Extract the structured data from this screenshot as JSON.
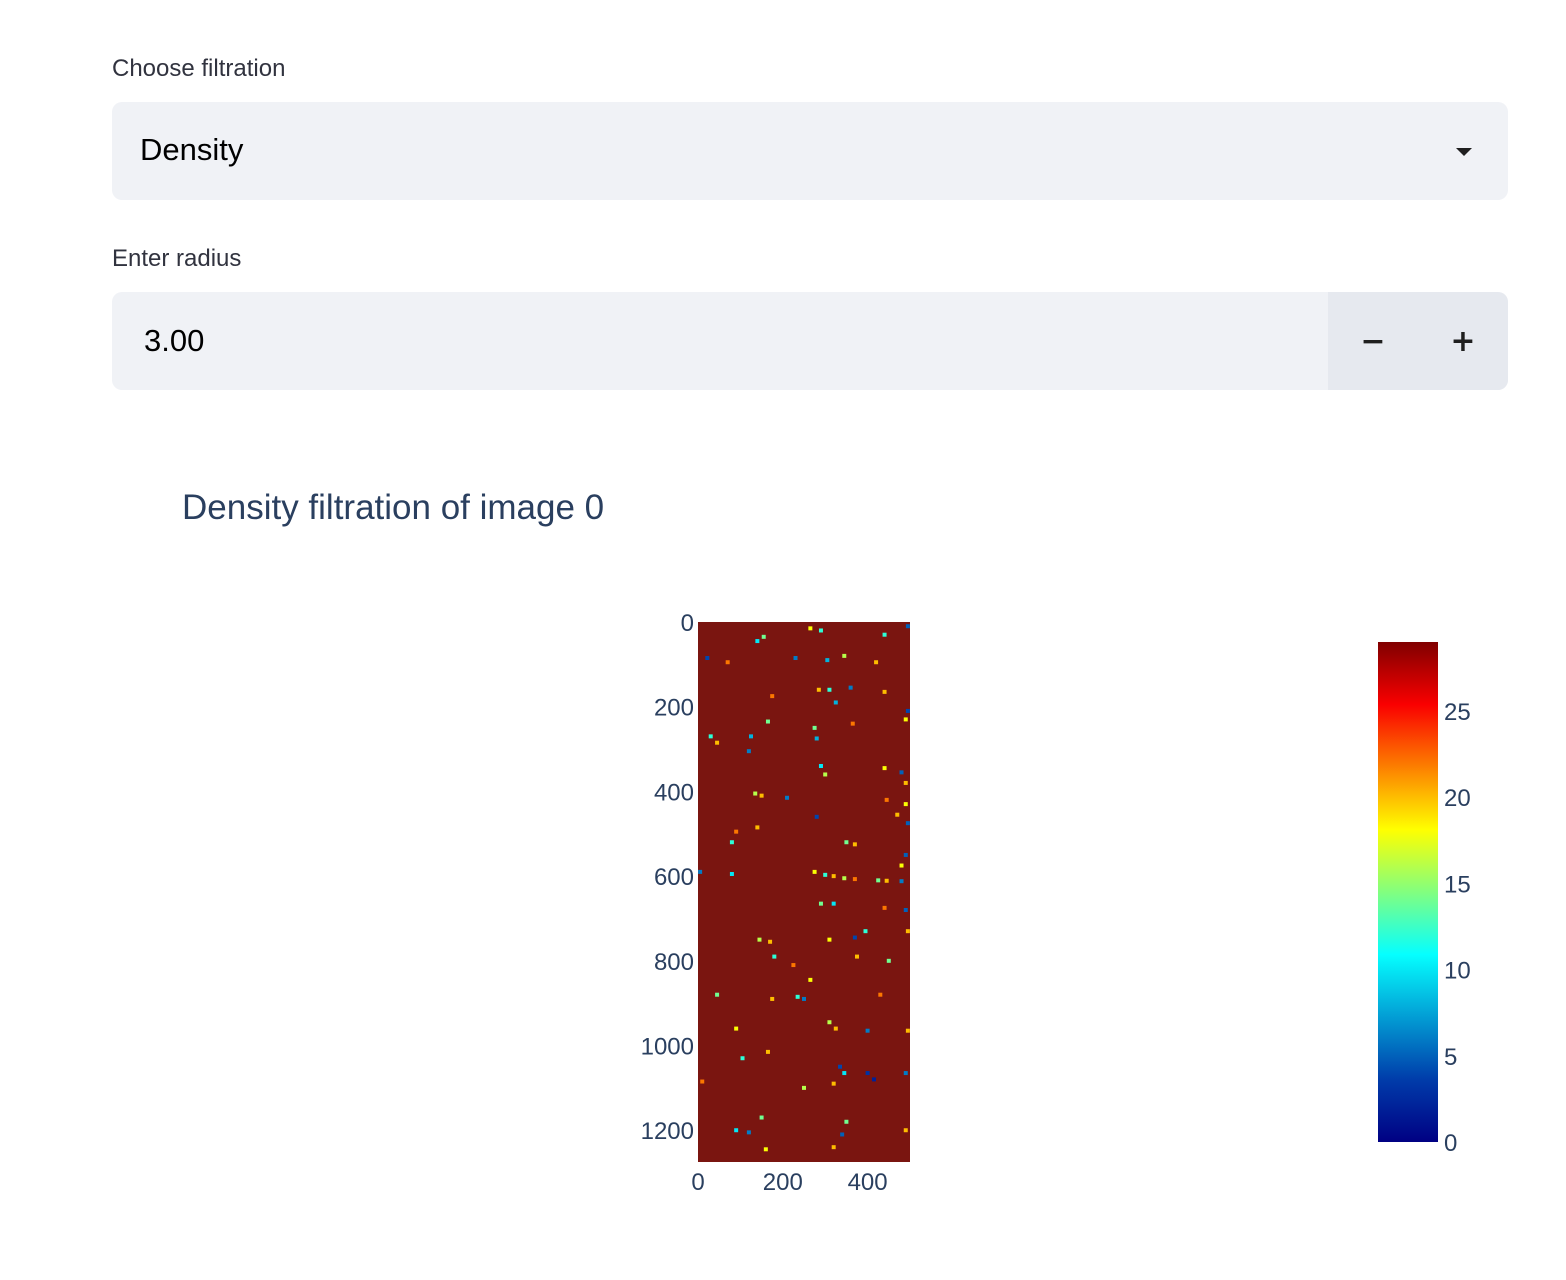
{
  "filtration": {
    "label": "Choose filtration",
    "selected": "Density"
  },
  "radius": {
    "label": "Enter radius",
    "value": "3.00",
    "minus": "−",
    "plus": "+"
  },
  "icons": {
    "dropdown": "chevron-down-icon",
    "decrement": "minus-icon",
    "increment": "plus-icon"
  },
  "chart_data": {
    "type": "heatmap",
    "title": "Density filtration of image 0",
    "xlabel": "",
    "ylabel": "",
    "x_range": [
      0,
      500
    ],
    "y_range": [
      0,
      1275
    ],
    "y_reversed": true,
    "x_ticks": [
      0,
      200,
      400
    ],
    "y_ticks": [
      0,
      200,
      400,
      600,
      800,
      1000,
      1200
    ],
    "colorscale": "Jet",
    "color_range": [
      0,
      29
    ],
    "colorbar_ticks": [
      0,
      5,
      10,
      15,
      20,
      25
    ],
    "background_value": 29,
    "grid": false,
    "points": [
      {
        "x": 22,
        "y": 85,
        "v": 4
      },
      {
        "x": 70,
        "y": 95,
        "v": 22
      },
      {
        "x": 140,
        "y": 45,
        "v": 10
      },
      {
        "x": 155,
        "y": 35,
        "v": 14
      },
      {
        "x": 230,
        "y": 85,
        "v": 6
      },
      {
        "x": 265,
        "y": 15,
        "v": 18
      },
      {
        "x": 290,
        "y": 20,
        "v": 12
      },
      {
        "x": 305,
        "y": 90,
        "v": 8
      },
      {
        "x": 345,
        "y": 80,
        "v": 16
      },
      {
        "x": 440,
        "y": 30,
        "v": 12
      },
      {
        "x": 420,
        "y": 95,
        "v": 20
      },
      {
        "x": 495,
        "y": 10,
        "v": 5
      },
      {
        "x": 285,
        "y": 160,
        "v": 20
      },
      {
        "x": 310,
        "y": 160,
        "v": 12
      },
      {
        "x": 360,
        "y": 155,
        "v": 6
      },
      {
        "x": 440,
        "y": 165,
        "v": 20
      },
      {
        "x": 325,
        "y": 190,
        "v": 8
      },
      {
        "x": 175,
        "y": 175,
        "v": 22
      },
      {
        "x": 495,
        "y": 210,
        "v": 4
      },
      {
        "x": 490,
        "y": 230,
        "v": 18
      },
      {
        "x": 165,
        "y": 235,
        "v": 14
      },
      {
        "x": 30,
        "y": 270,
        "v": 12
      },
      {
        "x": 45,
        "y": 285,
        "v": 20
      },
      {
        "x": 125,
        "y": 270,
        "v": 8
      },
      {
        "x": 120,
        "y": 305,
        "v": 6
      },
      {
        "x": 275,
        "y": 250,
        "v": 14
      },
      {
        "x": 280,
        "y": 275,
        "v": 8
      },
      {
        "x": 365,
        "y": 240,
        "v": 22
      },
      {
        "x": 290,
        "y": 340,
        "v": 10
      },
      {
        "x": 300,
        "y": 360,
        "v": 16
      },
      {
        "x": 440,
        "y": 345,
        "v": 18
      },
      {
        "x": 480,
        "y": 355,
        "v": 5
      },
      {
        "x": 490,
        "y": 380,
        "v": 20
      },
      {
        "x": 135,
        "y": 405,
        "v": 16
      },
      {
        "x": 150,
        "y": 410,
        "v": 20
      },
      {
        "x": 210,
        "y": 415,
        "v": 6
      },
      {
        "x": 445,
        "y": 420,
        "v": 22
      },
      {
        "x": 490,
        "y": 430,
        "v": 18
      },
      {
        "x": 280,
        "y": 460,
        "v": 4
      },
      {
        "x": 470,
        "y": 455,
        "v": 20
      },
      {
        "x": 495,
        "y": 475,
        "v": 5
      },
      {
        "x": 80,
        "y": 520,
        "v": 12
      },
      {
        "x": 90,
        "y": 495,
        "v": 22
      },
      {
        "x": 140,
        "y": 485,
        "v": 20
      },
      {
        "x": 350,
        "y": 520,
        "v": 14
      },
      {
        "x": 370,
        "y": 525,
        "v": 20
      },
      {
        "x": 490,
        "y": 550,
        "v": 5
      },
      {
        "x": 480,
        "y": 575,
        "v": 18
      },
      {
        "x": 5,
        "y": 590,
        "v": 6
      },
      {
        "x": 80,
        "y": 595,
        "v": 10
      },
      {
        "x": 275,
        "y": 590,
        "v": 18
      },
      {
        "x": 300,
        "y": 597,
        "v": 12
      },
      {
        "x": 320,
        "y": 600,
        "v": 20
      },
      {
        "x": 345,
        "y": 605,
        "v": 16
      },
      {
        "x": 370,
        "y": 607,
        "v": 22
      },
      {
        "x": 425,
        "y": 610,
        "v": 14
      },
      {
        "x": 445,
        "y": 611,
        "v": 20
      },
      {
        "x": 480,
        "y": 612,
        "v": 6
      },
      {
        "x": 290,
        "y": 665,
        "v": 14
      },
      {
        "x": 320,
        "y": 665,
        "v": 10
      },
      {
        "x": 490,
        "y": 680,
        "v": 5
      },
      {
        "x": 440,
        "y": 675,
        "v": 22
      },
      {
        "x": 395,
        "y": 730,
        "v": 12
      },
      {
        "x": 370,
        "y": 745,
        "v": 4
      },
      {
        "x": 145,
        "y": 750,
        "v": 16
      },
      {
        "x": 170,
        "y": 755,
        "v": 20
      },
      {
        "x": 180,
        "y": 790,
        "v": 12
      },
      {
        "x": 310,
        "y": 750,
        "v": 18
      },
      {
        "x": 495,
        "y": 730,
        "v": 20
      },
      {
        "x": 225,
        "y": 810,
        "v": 22
      },
      {
        "x": 375,
        "y": 790,
        "v": 20
      },
      {
        "x": 450,
        "y": 800,
        "v": 14
      },
      {
        "x": 265,
        "y": 845,
        "v": 18
      },
      {
        "x": 235,
        "y": 885,
        "v": 12
      },
      {
        "x": 250,
        "y": 890,
        "v": 6
      },
      {
        "x": 175,
        "y": 890,
        "v": 20
      },
      {
        "x": 45,
        "y": 880,
        "v": 14
      },
      {
        "x": 430,
        "y": 880,
        "v": 22
      },
      {
        "x": 310,
        "y": 945,
        "v": 16
      },
      {
        "x": 325,
        "y": 960,
        "v": 20
      },
      {
        "x": 90,
        "y": 960,
        "v": 18
      },
      {
        "x": 400,
        "y": 965,
        "v": 6
      },
      {
        "x": 495,
        "y": 965,
        "v": 20
      },
      {
        "x": 165,
        "y": 1015,
        "v": 20
      },
      {
        "x": 105,
        "y": 1030,
        "v": 12
      },
      {
        "x": 335,
        "y": 1050,
        "v": 4
      },
      {
        "x": 345,
        "y": 1065,
        "v": 10
      },
      {
        "x": 400,
        "y": 1065,
        "v": 3
      },
      {
        "x": 415,
        "y": 1080,
        "v": 2
      },
      {
        "x": 490,
        "y": 1065,
        "v": 6
      },
      {
        "x": 320,
        "y": 1090,
        "v": 20
      },
      {
        "x": 10,
        "y": 1085,
        "v": 22
      },
      {
        "x": 250,
        "y": 1100,
        "v": 16
      },
      {
        "x": 150,
        "y": 1170,
        "v": 14
      },
      {
        "x": 90,
        "y": 1200,
        "v": 10
      },
      {
        "x": 120,
        "y": 1205,
        "v": 6
      },
      {
        "x": 340,
        "y": 1210,
        "v": 5
      },
      {
        "x": 160,
        "y": 1245,
        "v": 18
      },
      {
        "x": 320,
        "y": 1240,
        "v": 20
      },
      {
        "x": 350,
        "y": 1180,
        "v": 14
      },
      {
        "x": 490,
        "y": 1200,
        "v": 20
      }
    ]
  }
}
